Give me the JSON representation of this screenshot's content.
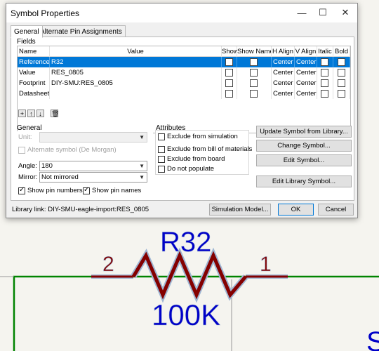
{
  "window": {
    "title": "Symbol Properties",
    "min_glyph": "—",
    "max_glyph": "☐",
    "close_glyph": "✕"
  },
  "tabs": [
    {
      "label": "General"
    },
    {
      "label": "Alternate Pin Assignments"
    }
  ],
  "fields": {
    "group_label": "Fields",
    "columns": [
      "Name",
      "Value",
      "Show",
      "Show Name",
      "H Align",
      "V Align",
      "Italic",
      "Bold"
    ],
    "rows": [
      {
        "name": "Reference",
        "value": "R32",
        "h_align": "Center",
        "v_align": "Center"
      },
      {
        "name": "Value",
        "value": "RES_0805",
        "h_align": "Center",
        "v_align": "Center"
      },
      {
        "name": "Footprint",
        "value": "DIY-SMU:RES_0805",
        "h_align": "Center",
        "v_align": "Center"
      },
      {
        "name": "Datasheet",
        "value": "",
        "h_align": "Center",
        "v_align": "Center"
      }
    ],
    "toolbar": {
      "add": "+",
      "up": "↑",
      "down": "↓",
      "delete": "🗑"
    }
  },
  "general": {
    "group_label": "General",
    "unit_label": "Unit:",
    "alternate_label": "Alternate symbol (De Morgan)",
    "angle_label": "Angle:",
    "angle_value": "180",
    "mirror_label": "Mirror:",
    "mirror_value": "Not mirrored",
    "show_pin_numbers": "Show pin numbers",
    "show_pin_names": "Show pin names"
  },
  "attributes": {
    "group_label": "Attributes",
    "exclude_sim": "Exclude from simulation",
    "exclude_bom": "Exclude from bill of materials",
    "exclude_board": "Exclude from board",
    "do_not_populate": "Do not populate"
  },
  "side_buttons": {
    "update": "Update Symbol from Library...",
    "change": "Change Symbol...",
    "edit": "Edit Symbol...",
    "edit_lib": "Edit Library Symbol..."
  },
  "footer": {
    "library_link": "Library link:  DIY-SMU-eagle-import:RES_0805",
    "simulation": "Simulation Model...",
    "ok": "OK",
    "cancel": "Cancel"
  },
  "schematic": {
    "reference": "R32",
    "value": "100K",
    "pin_left": "2",
    "pin_right": "1",
    "partial_glyph": "S",
    "colors": {
      "text": "#0000c8",
      "body": "#840000",
      "wire": "#008400",
      "pin_outline": "#9fb6d3",
      "background": "#f5f4ef"
    }
  }
}
